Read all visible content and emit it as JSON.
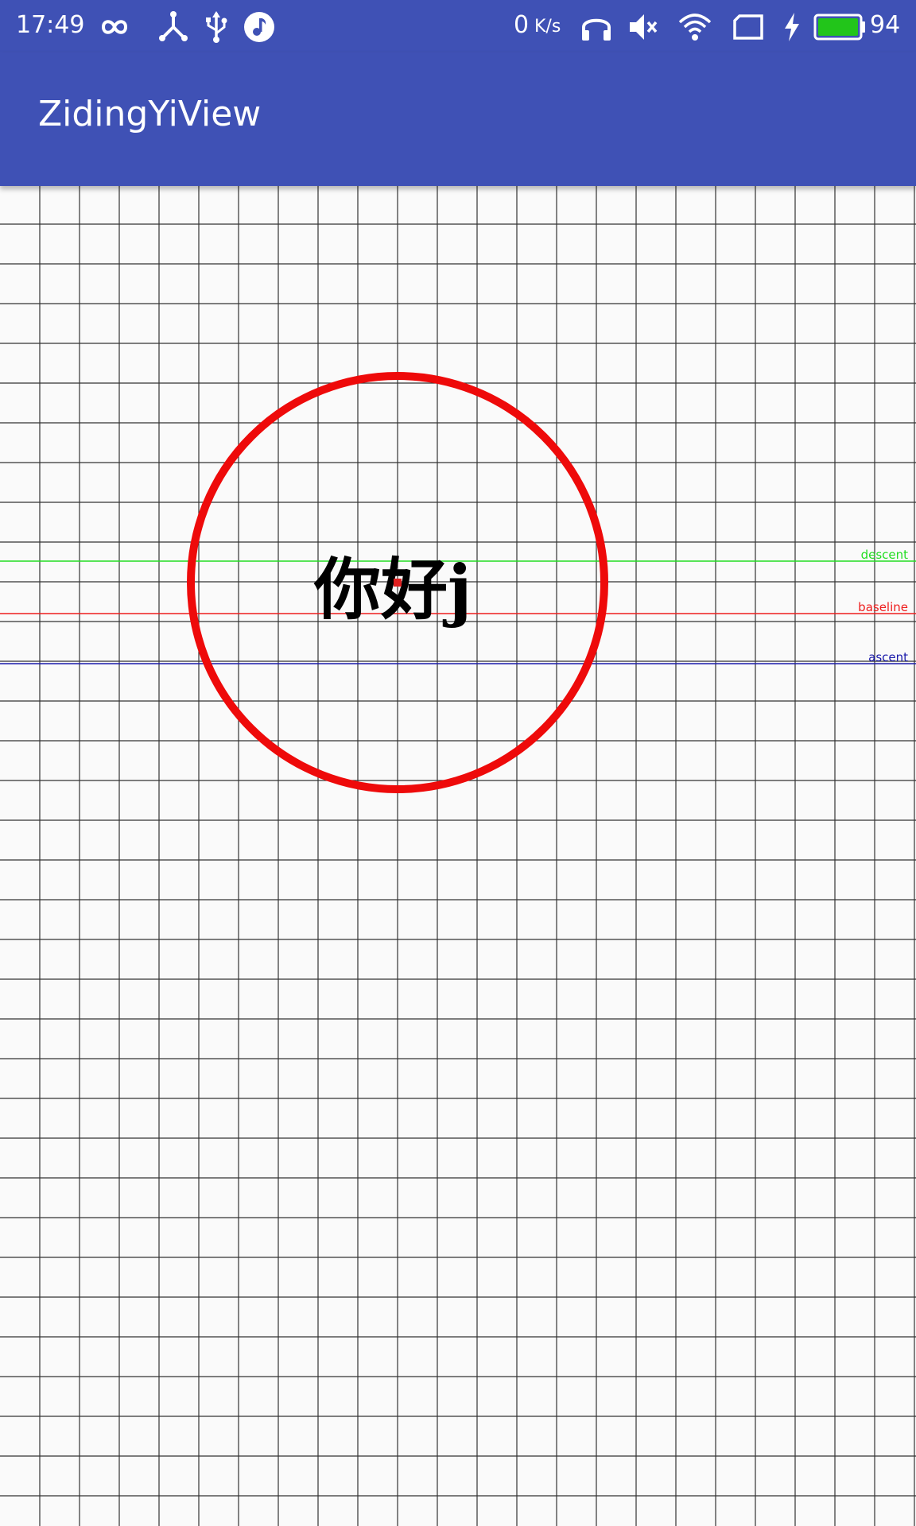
{
  "status_bar": {
    "time": "17:49",
    "net_speed_value": "0",
    "net_speed_unit": "K/s",
    "battery_level": "94",
    "background_color": "#3f51b5",
    "icons": {
      "infinity": "infinity-icon",
      "share": "share-network-icon",
      "usb": "usb-icon",
      "music": "music-note-icon",
      "headphones": "headphones-icon",
      "mute": "volume-mute-icon",
      "wifi": "wifi-icon",
      "sim": "sim-card-icon",
      "charging": "charging-bolt-icon",
      "battery": "battery-icon"
    },
    "battery_fill_color": "#22c51a"
  },
  "app_bar": {
    "title": "ZidingYiView",
    "background_color": "#3f51b5"
  },
  "custom_view": {
    "text": "你好j",
    "grid_line_color": "#333333",
    "circle_color": "#ee0a0a",
    "center_dot_color": "#e02020",
    "metric_lines": [
      {
        "label": "descent",
        "color": "#22dd22"
      },
      {
        "label": "baseline",
        "color": "#ee1c1c"
      },
      {
        "label": "ascent",
        "color": "#1a1aaa"
      }
    ]
  }
}
